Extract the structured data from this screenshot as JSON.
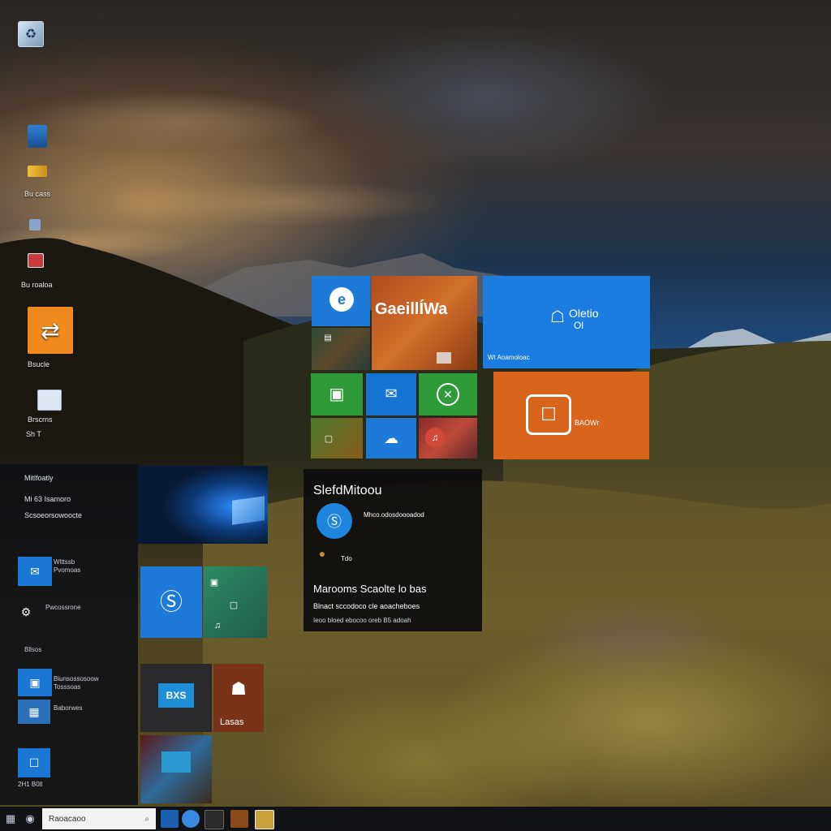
{
  "desktop": {
    "icons": [
      {
        "label": "",
        "name": "recycle-bin"
      },
      {
        "label": "",
        "name": "app-1"
      },
      {
        "label": "",
        "name": "app-2"
      },
      {
        "label": "Bu cass",
        "name": "app-3"
      },
      {
        "label": "",
        "name": "app-4"
      },
      {
        "label": "",
        "name": "app-5"
      },
      {
        "label": "Bu roaloa",
        "name": "app-6"
      },
      {
        "label": "",
        "name": "app-7"
      },
      {
        "label": "Bsucle",
        "name": "app-8"
      },
      {
        "label": "Brscrns",
        "name": "app-9"
      },
      {
        "label": "Sh T",
        "name": "app-10"
      }
    ]
  },
  "start_menu": {
    "list": [
      {
        "label": "Mitlfoatly"
      },
      {
        "label": "Mi 63 Isamoro"
      },
      {
        "label": "Scsoeorsowoocte"
      }
    ],
    "apps": [
      {
        "label": "Wlttssb Pvomoas",
        "icon": "mail-icon"
      },
      {
        "label": "Pwcossrone",
        "icon": "settings-icon"
      },
      {
        "label": "Bllsos",
        "icon": "store-icon"
      },
      {
        "label": "Biunsossosoow Tosssoas",
        "icon": "photos-icon"
      },
      {
        "label": "Baborwes",
        "icon": "calendar-icon"
      },
      {
        "label": "2H1 B0ll",
        "icon": "store-icon"
      }
    ]
  },
  "tiles": {
    "edge_tile": {
      "label": "",
      "icon": "edge-icon"
    },
    "banner_tile": {
      "label": "GaeillÍWa"
    },
    "store_tile": {
      "title": "Oletio",
      "subtitle": "Ol",
      "caption": "Wt Aoamoloac"
    },
    "office_tile": {
      "label": "BAOWr",
      "icon": "office-icon"
    },
    "smalls": [
      {
        "icon": "photos-icon"
      },
      {
        "icon": "mail-icon"
      },
      {
        "icon": "xbox-icon"
      },
      {
        "icon": "image-icon"
      },
      {
        "icon": "weather-icon"
      },
      {
        "icon": "music-icon"
      }
    ],
    "lower_left": [
      {
        "icon": "skype-icon",
        "label": ""
      },
      {
        "icon": "photos-icon",
        "label": ""
      },
      {
        "icon": "gallery-icon",
        "label": "BXS"
      },
      {
        "icon": "bag-icon",
        "label": "Lasas"
      }
    ]
  },
  "selected_tile": {
    "title": "SlefdMitoou",
    "link": "Mhco.odosdoooadod",
    "meta": "Tdo",
    "heading": "Marooms Scaolte lo bas",
    "line1": "Blnact sccodoco cle aoacheboes",
    "line2": "Ieoo bloed ebocoo oreb B5 adoah"
  },
  "taskbar": {
    "search_placeholder": "Raoacaoo"
  }
}
